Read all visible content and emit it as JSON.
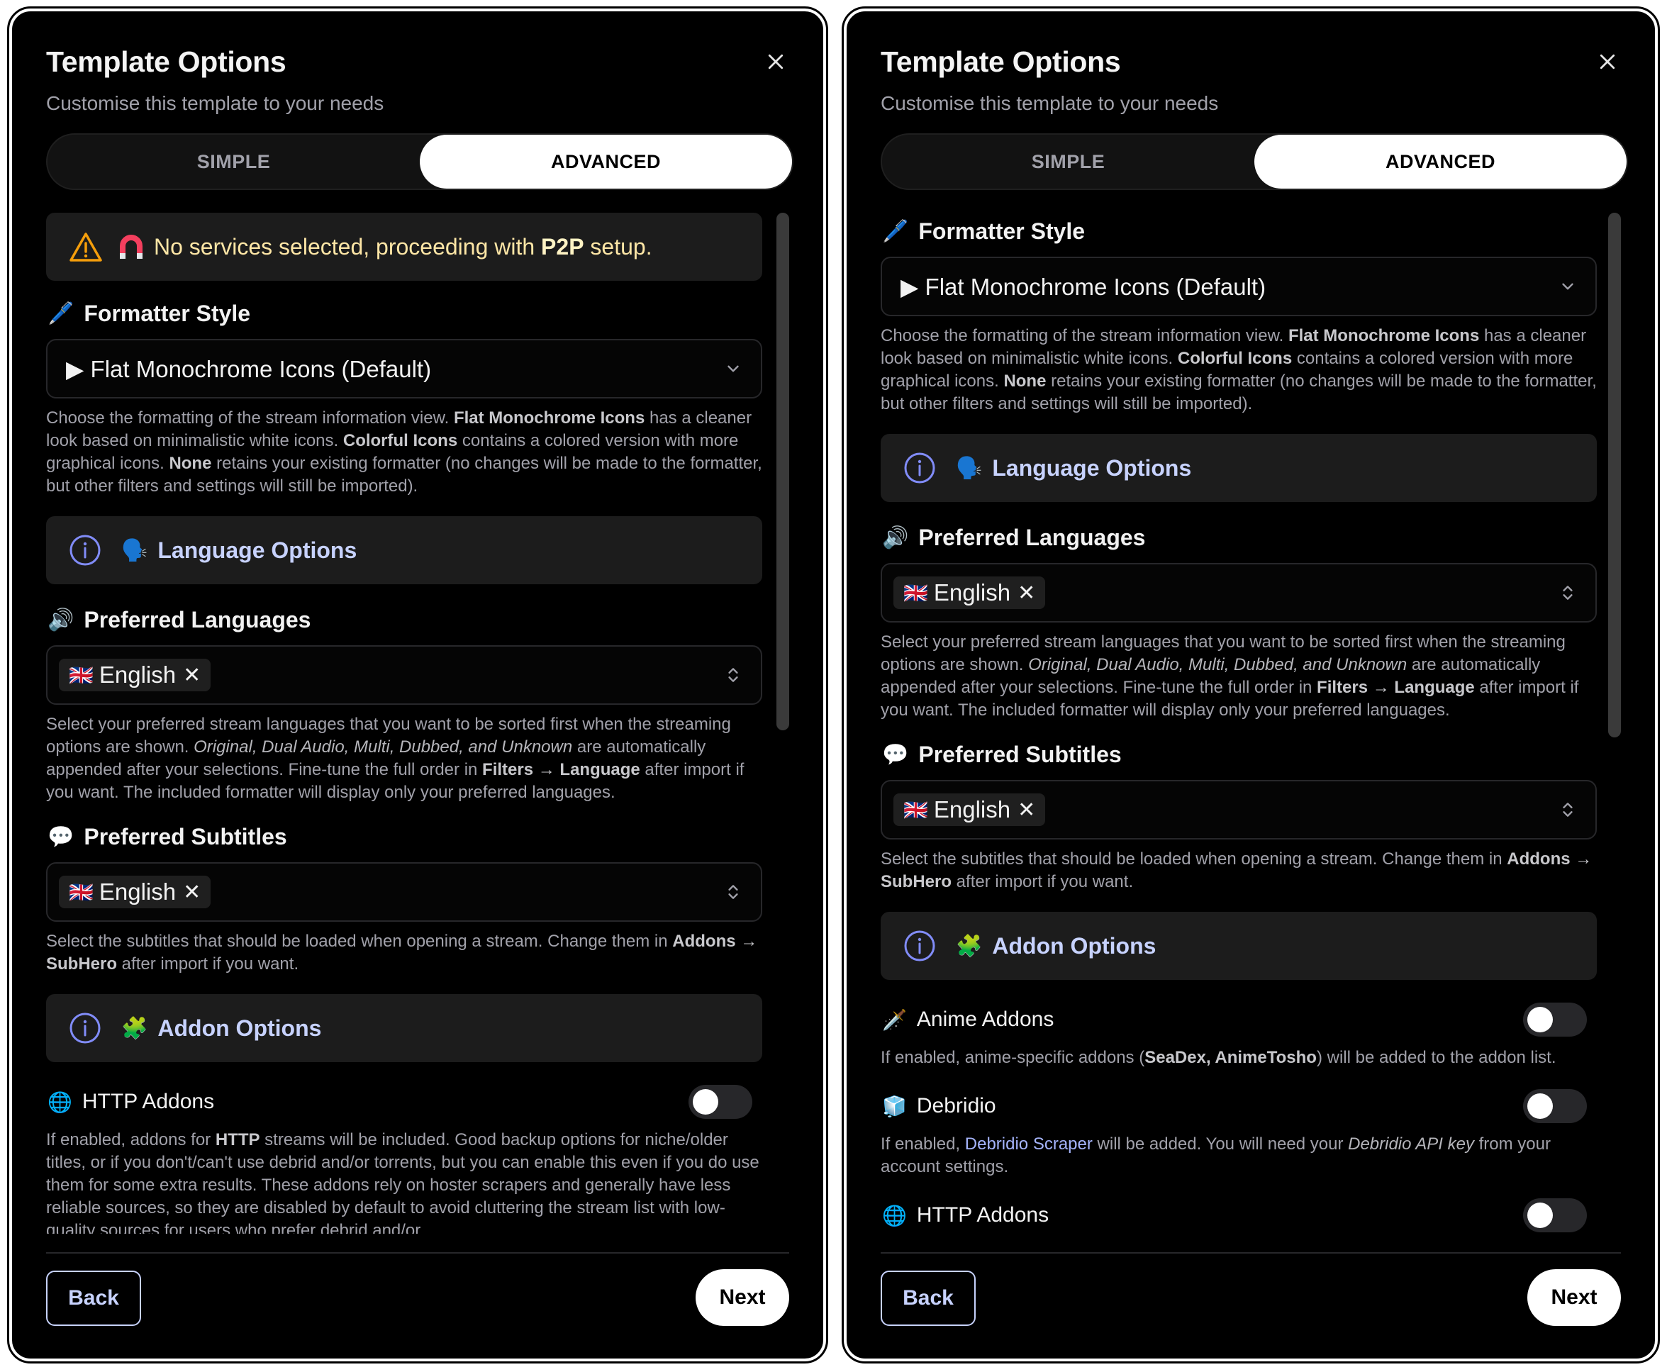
{
  "panels": [
    {
      "title": "Template Options",
      "subtitle": "Customise this template to your needs",
      "tabs": [
        "SIMPLE",
        "ADVANCED"
      ],
      "alert": {
        "prefix": "No services selected, proceeding with ",
        "bold": "P2P",
        "suffix": " setup."
      },
      "formatter": {
        "label": "Formatter Style",
        "emoji": "🖊️",
        "value": "▶ Flat Monochrome Icons (Default)"
      },
      "language_section": "Language Options",
      "preferred_languages": {
        "label": "Preferred Languages",
        "chip": "English"
      },
      "preferred_subtitles": {
        "label": "Preferred Subtitles",
        "chip": "English"
      },
      "addon_section": "Addon Options",
      "http_addons": {
        "label": "HTTP Addons",
        "help_1": "If enabled, addons for ",
        "help_bold": "HTTP",
        "help_2": " streams will be included. Good backup options for niche/older titles, or if you don't/can't use debrid and/or torrents, but you can enable this even if you do use them for some extra results. These addons rely on hoster scrapers and generally have less reliable sources, so they are disabled by default to avoid cluttering the stream list with low-quality sources for users who prefer debrid and/or"
      },
      "back_label": "Back",
      "next_label": "Next"
    },
    {
      "title": "Template Options",
      "subtitle": "Customise this template to your needs",
      "tabs": [
        "SIMPLE",
        "ADVANCED"
      ],
      "formatter": {
        "label": "Formatter Style",
        "emoji": "🖊️",
        "value": "▶ Flat Monochrome Icons (Default)"
      },
      "language_section": "Language Options",
      "preferred_languages": {
        "label": "Preferred Languages",
        "chip": "English"
      },
      "preferred_subtitles": {
        "label": "Preferred Subtitles",
        "chip": "English"
      },
      "addon_section": "Addon Options",
      "anime_addons": {
        "label": "Anime Addons",
        "help_1": "If enabled, anime-specific addons (",
        "help_bold": "SeaDex, AnimeTosho",
        "help_2": ") will be added to the addon list."
      },
      "debridio": {
        "label": "Debridio",
        "help_1": "If enabled, ",
        "help_link": "Debridio Scraper",
        "help_2": " will be added. You will need your ",
        "help_italic": "Debridio API key",
        "help_3": " from your account settings."
      },
      "http_addons": {
        "label": "HTTP Addons"
      },
      "back_label": "Back",
      "next_label": "Next"
    }
  ],
  "formatter_help": {
    "t1": "Choose the formatting of the stream information view. ",
    "b1": "Flat Monochrome Icons",
    "t2": " has a cleaner look based on minimalistic white icons. ",
    "b2": "Colorful Icons",
    "t3": " contains a colored version with more graphical icons. ",
    "b3": "None",
    "t4": " retains your existing formatter (no changes will be made to the formatter, but other filters and settings will still be imported)."
  },
  "languages_help": {
    "t1": "Select your preferred stream languages that you want to be sorted first when the streaming options are shown. ",
    "i1": "Original, Dual Audio, Multi, Dubbed, and Unknown",
    "t2": " are automatically appended after your selections. Fine-tune the full order in ",
    "b1": "Filters → Language",
    "t3": " after import if you want. The included formatter will display only your preferred languages."
  },
  "subtitles_help": {
    "t1": "Select the subtitles that should be loaded when opening a stream. Change them in ",
    "b1": "Addons → SubHero",
    "t2": " after import if you want."
  },
  "icons": {
    "close": "close-icon",
    "warning": "warning-triangle-icon",
    "magnet": "magnet-icon",
    "info": "info-circle-icon",
    "chevron": "chevron-down-icon",
    "updown": "chevron-up-down-icon"
  },
  "emojis": {
    "language": "🗣️",
    "speaker": "🔊",
    "speech": "💬",
    "puzzle": "🧩",
    "globe": "🌐",
    "dagger": "🗡️",
    "cube": "🧊",
    "flag": "🇬🇧"
  },
  "colors": {
    "accent": "#c7d2fe",
    "alert_text": "#fde6a6",
    "warning": "#f59e0b",
    "magnet": "#f43f5e",
    "muted": "#a1a1aa"
  }
}
